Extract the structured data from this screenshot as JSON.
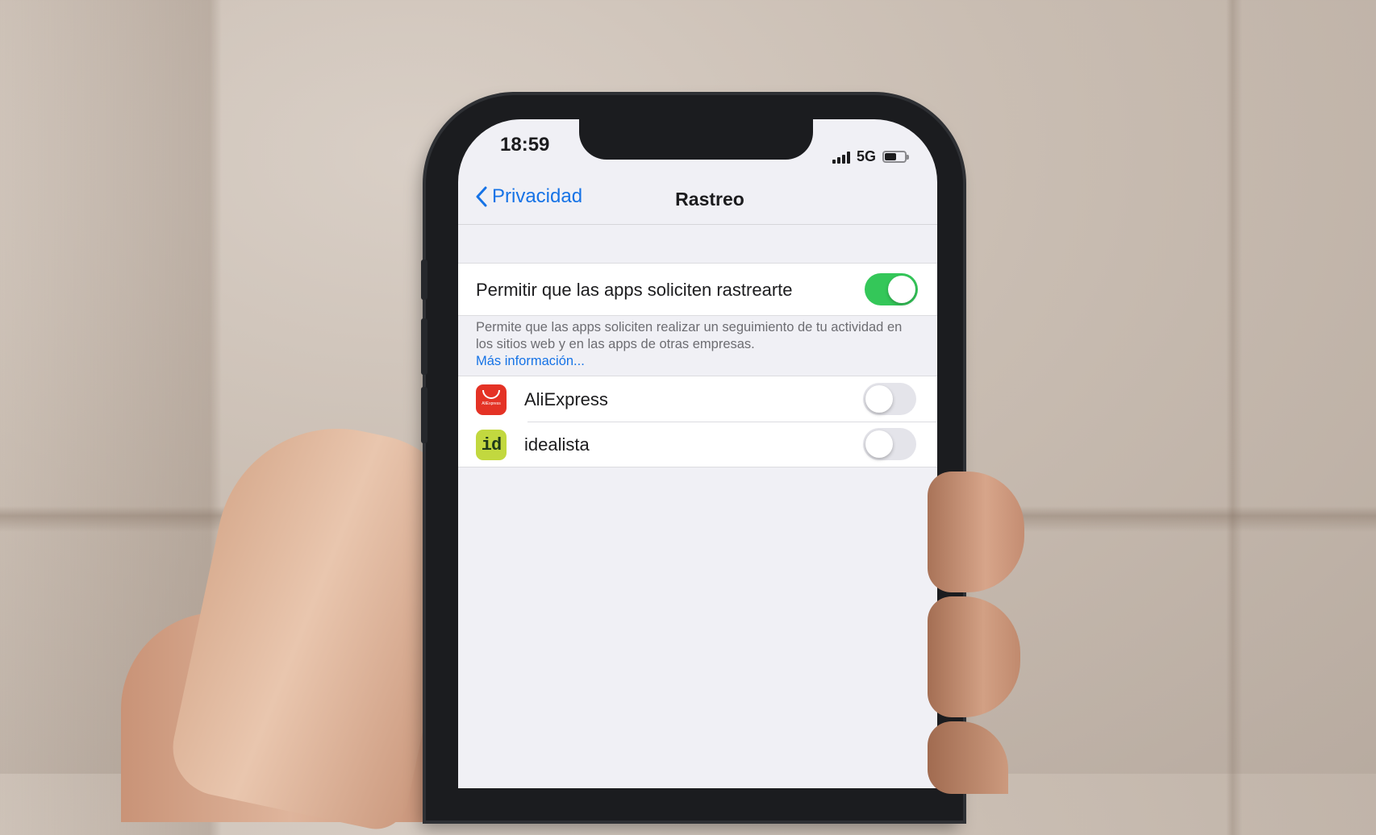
{
  "status_bar": {
    "time": "18:59",
    "network": "5G",
    "battery_level": 0.6
  },
  "nav": {
    "back_label": "Privacidad",
    "title": "Rastreo"
  },
  "allow_tracking": {
    "label": "Permitir que las apps soliciten rastrearte",
    "enabled": true,
    "description": "Permite que las apps soliciten realizar un seguimiento de tu actividad en los sitios web y en las apps de otras empresas.",
    "more_link": "Más información..."
  },
  "apps": [
    {
      "name": "AliExpress",
      "icon": "aliexpress-icon",
      "icon_text": "AliExpress",
      "enabled": false
    },
    {
      "name": "idealista",
      "icon": "idealista-icon",
      "icon_text": "id",
      "enabled": false
    }
  ],
  "colors": {
    "accent": "#1673e6",
    "toggle_on": "#34c759",
    "toggle_off": "#e4e4ea",
    "aliexpress": "#e43225",
    "idealista": "#c2d83f"
  }
}
